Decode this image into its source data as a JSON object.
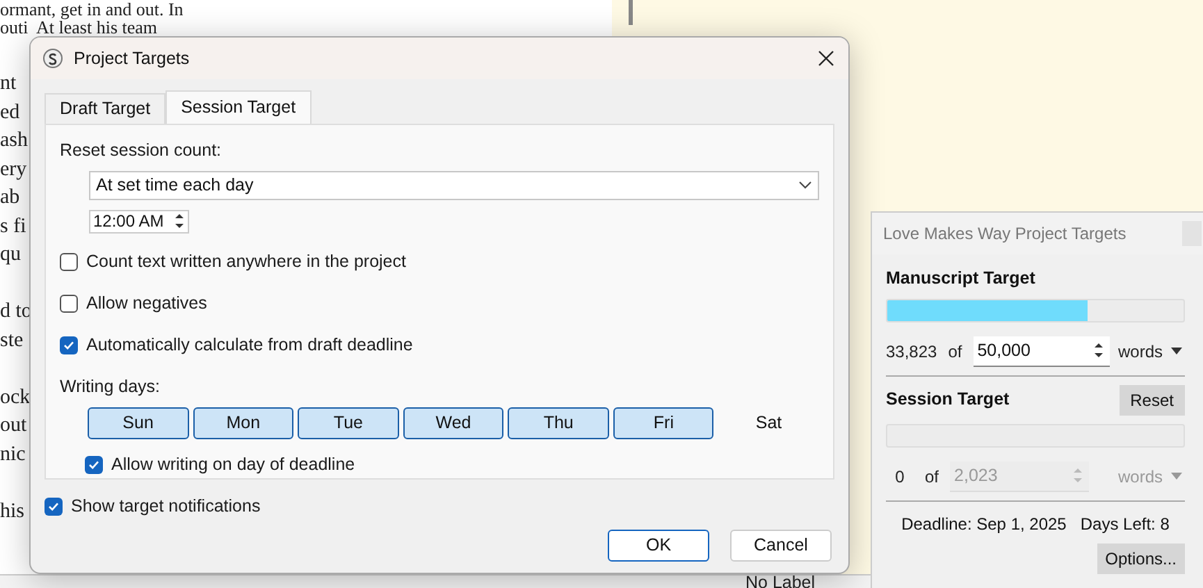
{
  "background_document": {
    "top_lines": [
      "ormant, get in and out. In",
      "outi  At least his team"
    ],
    "fragment_paragraphs": [
      [
        "nt",
        "ed",
        "ash",
        "ery",
        "ab",
        "s fi",
        "qu"
      ],
      [
        "d to",
        "ste"
      ],
      [
        "ock",
        "out",
        "nic"
      ],
      [
        "his"
      ]
    ]
  },
  "status_bar": {
    "label": "No Label"
  },
  "dialog": {
    "title": "Project Targets",
    "tabs": [
      {
        "label": "Draft Target",
        "selected": false
      },
      {
        "label": "Session Target",
        "selected": true
      }
    ],
    "reset_label": "Reset session count:",
    "reset_mode": "At set time each day",
    "reset_time": "12:00 AM",
    "options": [
      {
        "label": "Count text written anywhere in the project",
        "checked": false
      },
      {
        "label": "Allow negatives",
        "checked": false
      },
      {
        "label": "Automatically calculate from draft deadline",
        "checked": true
      }
    ],
    "writing_days_label": "Writing days:",
    "days": [
      {
        "label": "Sun",
        "selected": true
      },
      {
        "label": "Mon",
        "selected": true
      },
      {
        "label": "Tue",
        "selected": true
      },
      {
        "label": "Wed",
        "selected": true
      },
      {
        "label": "Thu",
        "selected": true
      },
      {
        "label": "Fri",
        "selected": true
      },
      {
        "label": "Sat",
        "selected": false
      }
    ],
    "deadline_day": {
      "label": "Allow writing on day of deadline",
      "checked": true
    },
    "notifications": {
      "label": "Show target notifications",
      "checked": true
    },
    "buttons": [
      "OK",
      "Cancel"
    ]
  },
  "targets_panel": {
    "title": "Love Makes Way Project Targets",
    "manuscript": {
      "heading": "Manuscript Target",
      "level": 0.676,
      "count": "33,823",
      "of": "of",
      "target": "50,000",
      "unit": "words",
      "disabled": false
    },
    "session": {
      "heading": "Session Target",
      "reset": "Reset",
      "count": "0",
      "of": "of",
      "target": "2,023",
      "unit": "words",
      "disabled": true
    },
    "deadline": "Deadline: Sep 1, 2025",
    "days_left": "Days Left: 8",
    "options_button": "Options..."
  }
}
